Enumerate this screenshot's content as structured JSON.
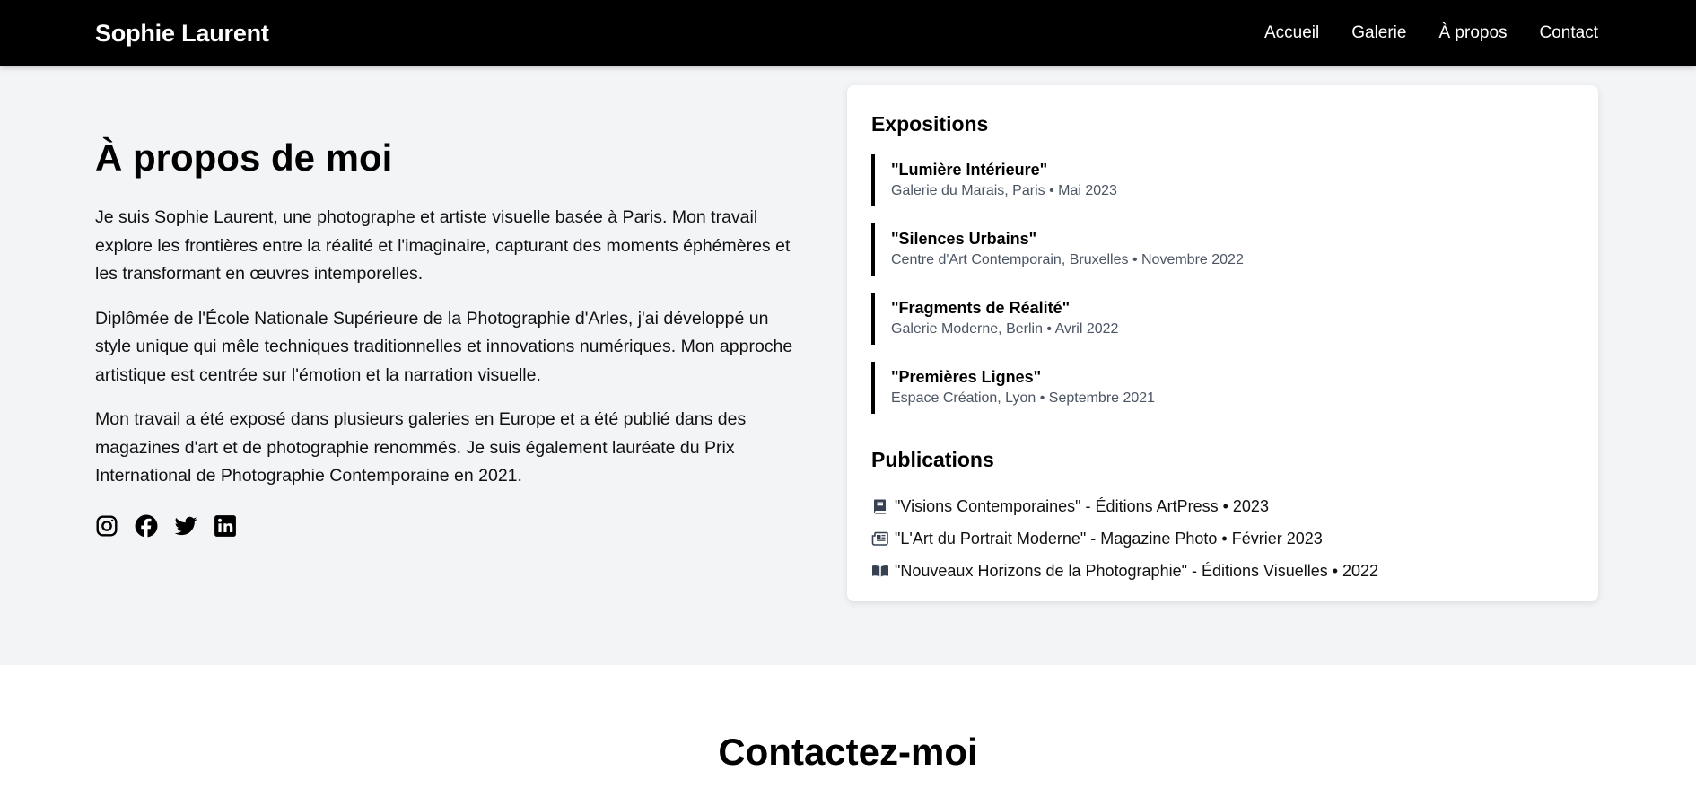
{
  "nav": {
    "brand": "Sophie Laurent",
    "links": [
      "Accueil",
      "Galerie",
      "À propos",
      "Contact"
    ]
  },
  "about": {
    "title": "À propos de moi",
    "paragraphs": [
      "Je suis Sophie Laurent, une photographe et artiste visuelle basée à Paris. Mon travail explore les frontières entre la réalité et l'imaginaire, capturant des moments éphémères et les transformant en œuvres intemporelles.",
      "Diplômée de l'École Nationale Supérieure de la Photographie d'Arles, j'ai développé un style unique qui mêle techniques traditionnelles et innovations numériques. Mon approche artistique est centrée sur l'émotion et la narration visuelle.",
      "Mon travail a été exposé dans plusieurs galeries en Europe et a été publié dans des magazines d'art et de photographie renommés. Je suis également lauréate du Prix International de Photographie Contemporaine en 2021."
    ],
    "socials": [
      "instagram-icon",
      "facebook-icon",
      "twitter-icon",
      "linkedin-icon"
    ]
  },
  "card": {
    "exhibitions_heading": "Expositions",
    "exhibitions": [
      {
        "title": "\"Lumière Intérieure\"",
        "meta": "Galerie du Marais, Paris • Mai 2023"
      },
      {
        "title": "\"Silences Urbains\"",
        "meta": "Centre d'Art Contemporain, Bruxelles • Novembre 2022"
      },
      {
        "title": "\"Fragments de Réalité\"",
        "meta": "Galerie Moderne, Berlin • Avril 2022"
      },
      {
        "title": "\"Premières Lignes\"",
        "meta": "Espace Création, Lyon • Septembre 2021"
      }
    ],
    "publications_heading": "Publications",
    "publications": [
      {
        "icon": "book-icon",
        "text": "\"Visions Contemporaines\" - Éditions ArtPress • 2023"
      },
      {
        "icon": "newspaper-icon",
        "text": "\"L'Art du Portrait Moderne\" - Magazine Photo • Février 2023"
      },
      {
        "icon": "book-open-icon",
        "text": "\"Nouveaux Horizons de la Photographie\" - Éditions Visuelles • 2022"
      }
    ]
  },
  "contact": {
    "title": "Contactez-moi"
  },
  "colors": {
    "nav_bg": "#000000",
    "page_bg": "#f3f4f6",
    "card_bg": "#ffffff",
    "muted_text": "#4b5563",
    "accent_border": "#000000"
  }
}
